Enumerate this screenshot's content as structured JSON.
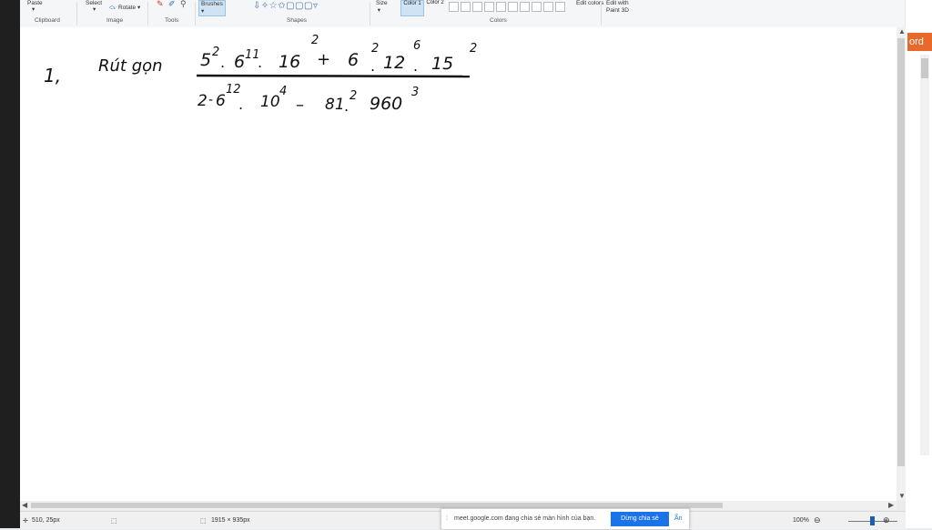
{
  "ribbon": {
    "paste": "Paste",
    "select": "Select",
    "rotate": "Rotate",
    "brushes": "Brushes",
    "size": "Size",
    "color1": "Color 1",
    "color2": "Color 2",
    "edit_colors": "Edit colors",
    "edit_paint3d": "Edit with Paint 3D",
    "groups": {
      "clipboard": "Clipboard",
      "image": "Image",
      "tools": "Tools",
      "shapes": "Shapes",
      "colors": "Colors"
    }
  },
  "side_tab": "ord",
  "drawing": {
    "item_number": "1,",
    "instruction": "Rút gọn",
    "numerator": {
      "t1_base": "5",
      "t1_exp": "2",
      "t2_base": "6",
      "t2_exp": "11",
      "t3_base": "16",
      "t3_exp": "2",
      "plus": "+",
      "t4_base": "6",
      "t4_exp": "2",
      "t5_base": "12",
      "t5_exp": "6",
      "t6_base": "15",
      "t6_exp": "2"
    },
    "denominator": {
      "t1": "2",
      "t2_base": "6",
      "t2_exp": "12",
      "t3_base": "10",
      "t3_exp": "4",
      "minus": "–",
      "t4_base": "81",
      "t4_exp": "2",
      "t5_base": "960",
      "t5_exp": "3"
    }
  },
  "status": {
    "cursor_pos": "510, 25px",
    "canvas_size": "1915 × 935px",
    "zoom": "100%"
  },
  "share_bar": {
    "message": "meet.google.com đang chia sẻ màn hình của bạn.",
    "stop_button": "Dừng chia sẻ",
    "hide": "Ẩn"
  }
}
